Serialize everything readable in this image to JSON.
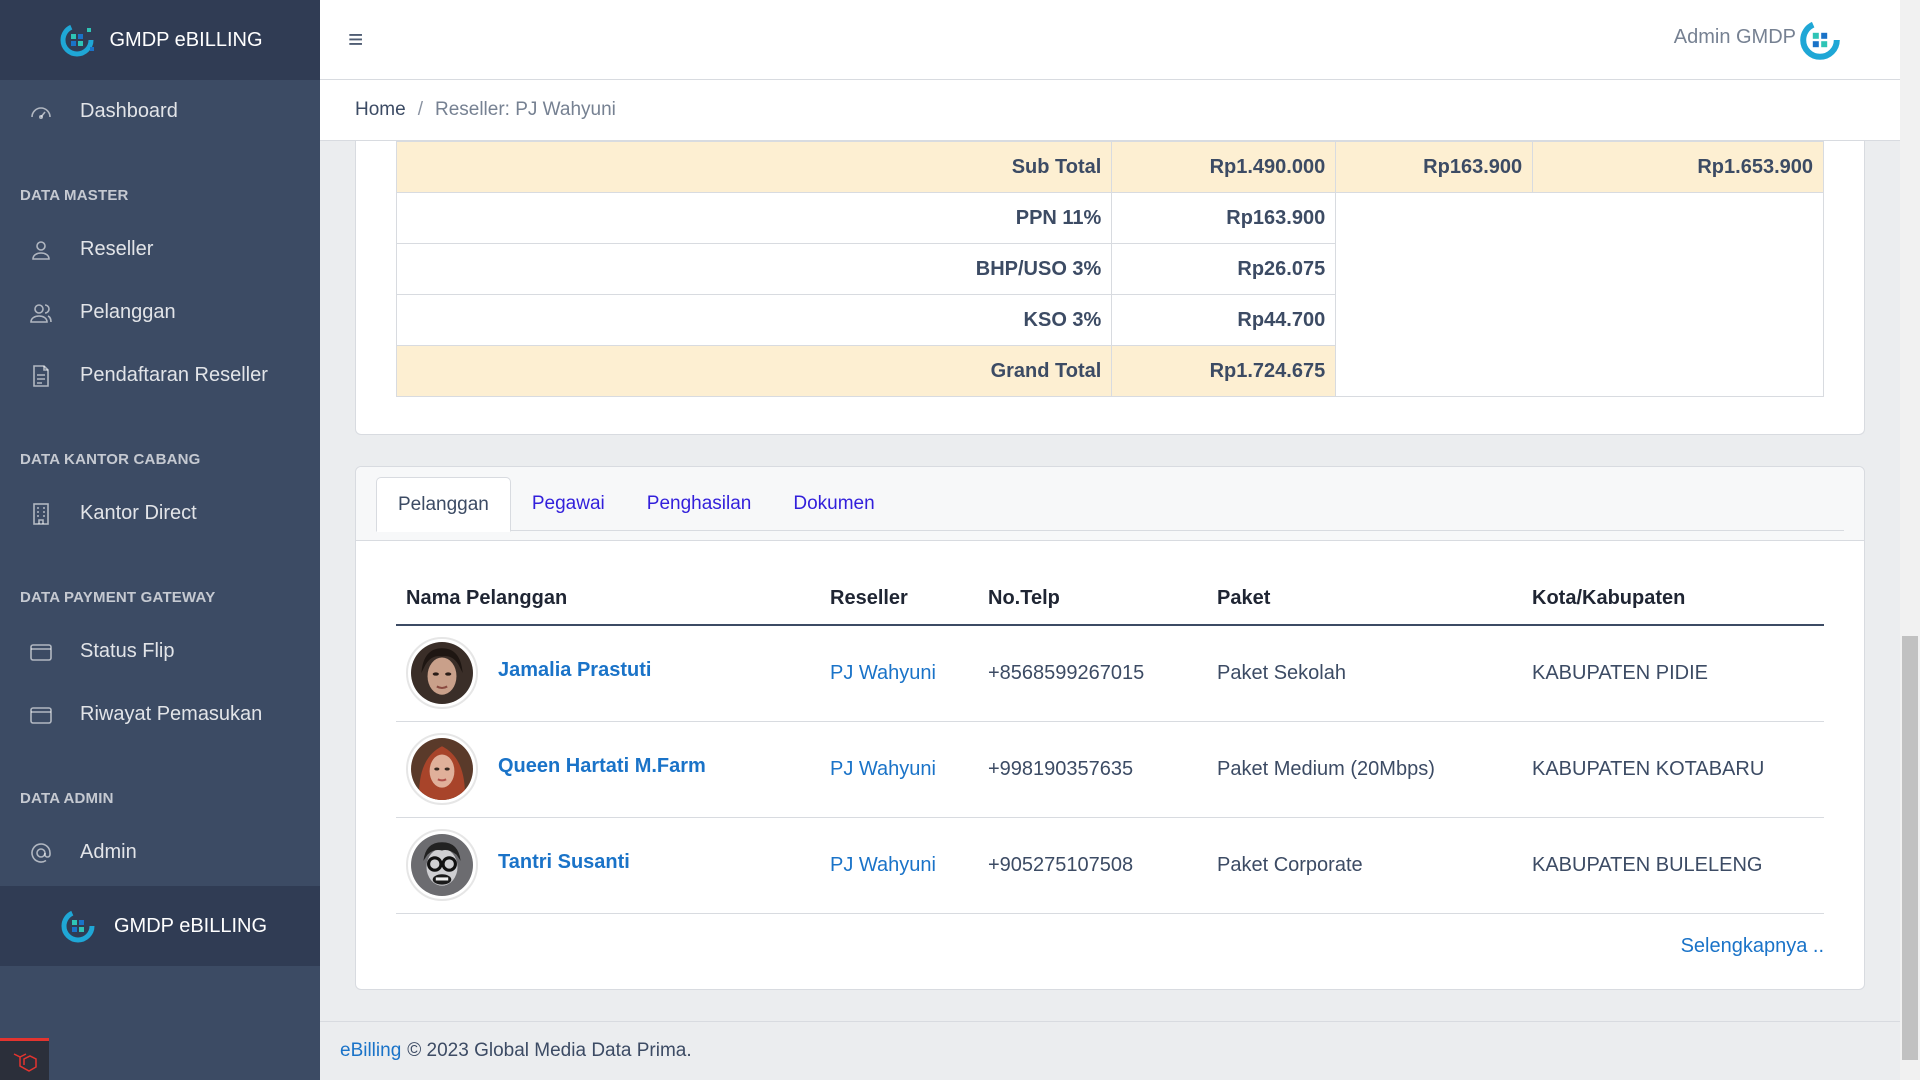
{
  "brand": {
    "name": "GMDP eBILLING"
  },
  "sidebar": {
    "dashboard": "Dashboard",
    "sections": [
      {
        "title": "DATA MASTER",
        "items": [
          "Reseller",
          "Pelanggan",
          "Pendaftaran Reseller"
        ]
      },
      {
        "title": "DATA KANTOR CABANG",
        "items": [
          "Kantor Direct"
        ]
      },
      {
        "title": "DATA PAYMENT GATEWAY",
        "items": [
          "Status Flip",
          "Riwayat Pemasukan"
        ]
      },
      {
        "title": "DATA ADMIN",
        "items": [
          "Admin"
        ]
      }
    ],
    "footer_brand": "GMDP eBILLING"
  },
  "header": {
    "menu_icon": "≡",
    "user_name": "Admin GMDP"
  },
  "breadcrumb": {
    "home": "Home",
    "separator": "/",
    "current": "Reseller: PJ Wahyuni"
  },
  "totals": {
    "rows": [
      {
        "label": "Sub Total",
        "value": "Rp1.490.000",
        "extra1": "Rp163.900",
        "extra2": "Rp1.653.900"
      },
      {
        "label": "PPN 11%",
        "value": "Rp163.900"
      },
      {
        "label": "BHP/USO 3%",
        "value": "Rp26.075"
      },
      {
        "label": "KSO 3%",
        "value": "Rp44.700"
      },
      {
        "label": "Grand Total",
        "value": "Rp1.724.675"
      }
    ]
  },
  "tabs": [
    "Pelanggan",
    "Pegawai",
    "Penghasilan",
    "Dokumen"
  ],
  "customers": {
    "headers": [
      "Nama Pelanggan",
      "Reseller",
      "No.Telp",
      "Paket",
      "Kota/Kabupaten"
    ],
    "rows": [
      {
        "name": "Jamalia Prastuti",
        "reseller": "PJ Wahyuni",
        "phone": "+8568599267015",
        "package": "Paket Sekolah",
        "city": "KABUPATEN PIDIE"
      },
      {
        "name": "Queen Hartati M.Farm",
        "reseller": "PJ Wahyuni",
        "phone": "+998190357635",
        "package": "Paket Medium (20Mbps)",
        "city": "KABUPATEN KOTABARU"
      },
      {
        "name": "Tantri Susanti",
        "reseller": "PJ Wahyuni",
        "phone": "+905275107508",
        "package": "Paket Corporate",
        "city": "KABUPATEN BULELENG"
      }
    ],
    "more": "Selengkapnya .."
  },
  "footer": {
    "link": "eBilling",
    "text": "© 2023 Global Media Data Prima."
  },
  "colors": {
    "sidebar": "#3c4b64",
    "sidebar_brand": "#303c54",
    "link": "#1a73c8",
    "tab_link": "#321fdb",
    "highlight_row": "#fdefd2"
  }
}
